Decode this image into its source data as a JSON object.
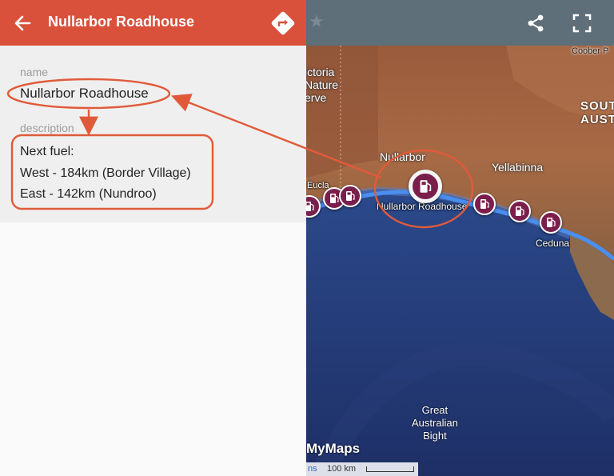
{
  "header": {
    "title": "Nullarbor Roadhouse",
    "color": "#d9513b"
  },
  "details": {
    "name_label": "name",
    "name_value": "Nullarbor Roadhouse",
    "description_label": "description",
    "description_lines": [
      "Next fuel:",
      "West - 184km (Border Village)",
      "East - 142km (Nundroo)"
    ]
  },
  "map": {
    "labels": {
      "victoria_nature_reserve": [
        "ictoria",
        "Nature",
        "erve"
      ],
      "coober_pedy": "Coober P",
      "south_australia": [
        "SOUT",
        "AUSTR"
      ],
      "nullarbor": "Nullarbor",
      "yellabinna": "Yellabinna",
      "eucla": "Eucla",
      "nullarbor_roadhouse": "Nullarbor Roadhouse",
      "ceduna": "Ceduna",
      "great_australian_bight": [
        "Great",
        "Australian",
        "Bight"
      ]
    },
    "logo": "MyMaps",
    "terms": "ns",
    "scale": "100 km",
    "route_color": "#4a8ef0",
    "pin_color": "#7a1f4c"
  },
  "icons": {
    "back": "arrow-left-icon",
    "directions": "directions-icon",
    "share": "share-icon",
    "fullscreen": "fullscreen-icon",
    "fuel": "fuel-pump-icon",
    "star": "star-icon"
  },
  "annotation_color": "#e05a3a"
}
